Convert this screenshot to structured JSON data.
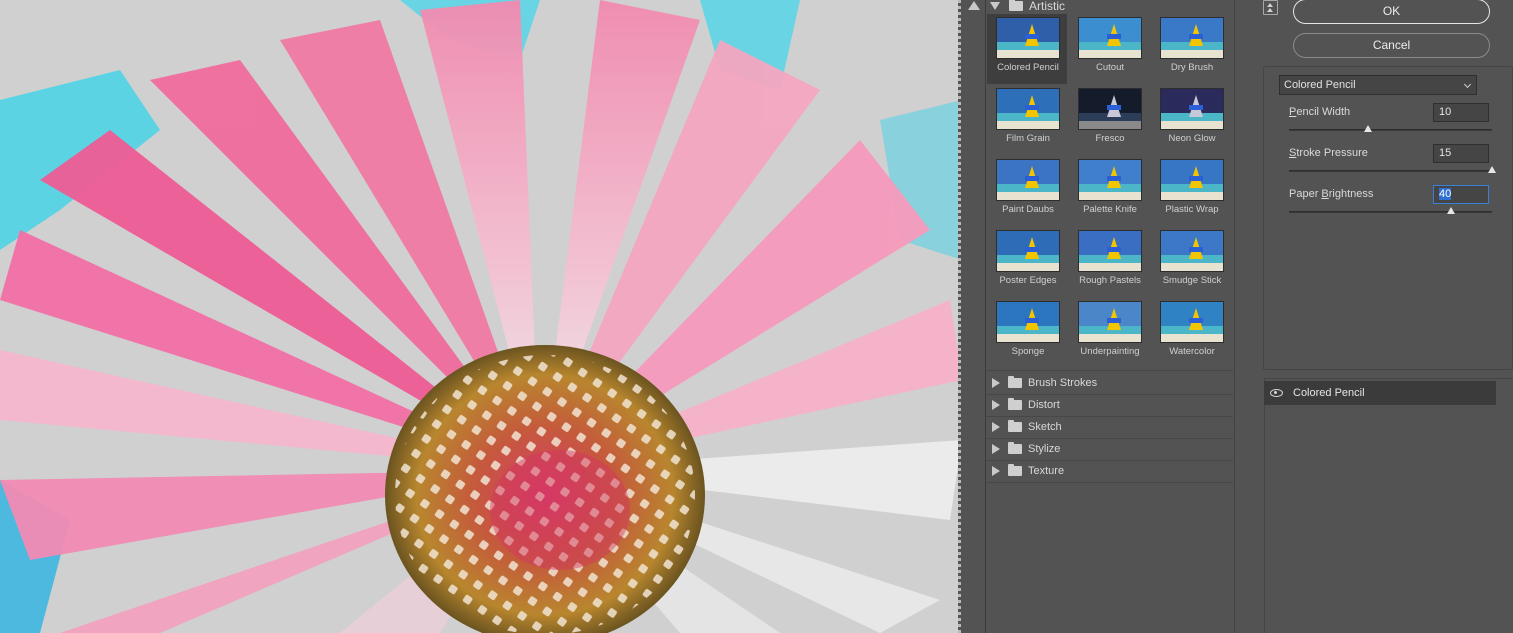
{
  "gallery": {
    "open_category": {
      "label": "Artistic"
    },
    "filters": [
      {
        "label": "Colored Pencil",
        "selected": true
      },
      {
        "label": "Cutout",
        "selected": false
      },
      {
        "label": "Dry Brush",
        "selected": false
      },
      {
        "label": "Film Grain",
        "selected": false
      },
      {
        "label": "Fresco",
        "selected": false
      },
      {
        "label": "Neon Glow",
        "selected": false
      },
      {
        "label": "Paint Daubs",
        "selected": false
      },
      {
        "label": "Palette Knife",
        "selected": false
      },
      {
        "label": "Plastic Wrap",
        "selected": false
      },
      {
        "label": "Poster Edges",
        "selected": false
      },
      {
        "label": "Rough Pastels",
        "selected": false
      },
      {
        "label": "Smudge Stick",
        "selected": false
      },
      {
        "label": "Sponge",
        "selected": false
      },
      {
        "label": "Underpainting",
        "selected": false
      },
      {
        "label": "Watercolor",
        "selected": false
      }
    ],
    "collapsed_categories": [
      {
        "label": "Brush Strokes"
      },
      {
        "label": "Distort"
      },
      {
        "label": "Sketch"
      },
      {
        "label": "Stylize"
      },
      {
        "label": "Texture"
      }
    ]
  },
  "dialog": {
    "ok_label": "OK",
    "cancel_label": "Cancel"
  },
  "settings": {
    "filter_select": {
      "value": "Colored Pencil"
    },
    "params": [
      {
        "key": "P",
        "rest": "encil Width",
        "value": "10",
        "level": 0.39,
        "focused": false
      },
      {
        "key": "S",
        "rest": "troke Pressure",
        "value": "15",
        "level": 1.0,
        "focused": false
      },
      {
        "key": "B",
        "rest": "rightness",
        "prefix": "Paper ",
        "value": "40",
        "level": 0.8,
        "focused": true
      }
    ]
  },
  "layers": {
    "items": [
      {
        "label": "Colored Pencil",
        "visible": true
      }
    ]
  },
  "colors": {
    "panel_bg": "#535353",
    "selected_bg": "#3e3e3e",
    "focus_accent": "#3a7fd6"
  }
}
